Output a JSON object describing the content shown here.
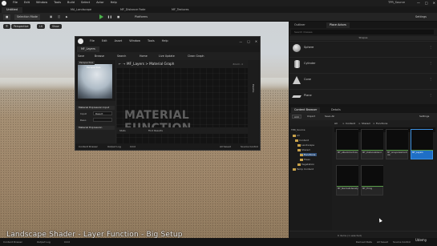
{
  "menubar": {
    "menus": [
      "File",
      "Edit",
      "Window",
      "Tools",
      "Build",
      "Select",
      "Actor",
      "Help"
    ],
    "right_text": "TPR_Source",
    "win": [
      "—",
      "□",
      "✕"
    ]
  },
  "level_tabs": [
    "Untitled",
    "MA_Landscape",
    "MF_Distance Fade",
    "MF_Textures"
  ],
  "toolbar": {
    "mode": "Selection Mode",
    "platforms": "Platforms",
    "settings": "Settings"
  },
  "viewport": {
    "perspective": "Perspective",
    "lit": "Lit",
    "show": "Show"
  },
  "material_editor": {
    "menus": [
      "File",
      "Edit",
      "Asset",
      "Window",
      "Tools",
      "Help"
    ],
    "tab": "MF_Layers",
    "tools": [
      "Save",
      "Browse",
      "Search",
      "Home",
      "Live Update",
      "Clean Graph"
    ],
    "preview_button": "Perspective",
    "preview_label": "Perspective",
    "details": {
      "sec_expressions": "Material Expression Input",
      "input_label": "Input",
      "input_value": "Result",
      "desc_label": "Desc.",
      "sec_function": "Material Expression"
    },
    "graph_title": "MF_Layers",
    "graph_sub": "Material Graph",
    "zoom": "Zoom -1",
    "watermark": "MATERIAL FUNCTION",
    "palette": "Palette",
    "graph_bottom": [
      "Stats",
      "Find Results"
    ],
    "status": [
      "Content Drawer",
      "Output Log",
      "Cmd",
      "All Saved",
      "Source Control"
    ]
  },
  "outliner": {
    "tabs": [
      "Outliner",
      "Place Actors"
    ],
    "search": "Search Classes",
    "section": "Shapes",
    "shapes": [
      "Sphere",
      "Cylinder",
      "Cone",
      "Plane"
    ]
  },
  "content_browser": {
    "tabs": [
      "Content Browser",
      "Details"
    ],
    "tools": [
      "Add",
      "Import",
      "Save All",
      "Settings"
    ],
    "path": [
      "All",
      "Content",
      "Shared",
      "Functions"
    ],
    "search": "Search Functions",
    "tree": [
      "TPR_Source",
      "All",
      "Content",
      "Landscape",
      "Shared",
      "Functions",
      "Trees",
      "Vegetation",
      "Temp Content"
    ],
    "assets": [
      "MF_AlbedoControls",
      "MF_Distanceblend",
      "MF_GrayscaleControls",
      "MF_Layers",
      "MF_NormalIntensity",
      "MF_Tiling"
    ],
    "collections": "Collections",
    "count": "6 items (1 selected)"
  },
  "statusbar": [
    "Content Drawer",
    "Output Log",
    "Cmd",
    "Derived Data",
    "All Saved",
    "Source Control"
  ],
  "caption": "Landscape Shader - Layer Function - Big Setup",
  "udemy": "Udemy",
  "colors": {
    "accent_blue": "#1f6fc6",
    "play_green": "#4bb34b",
    "folder": "#c9a24a"
  }
}
